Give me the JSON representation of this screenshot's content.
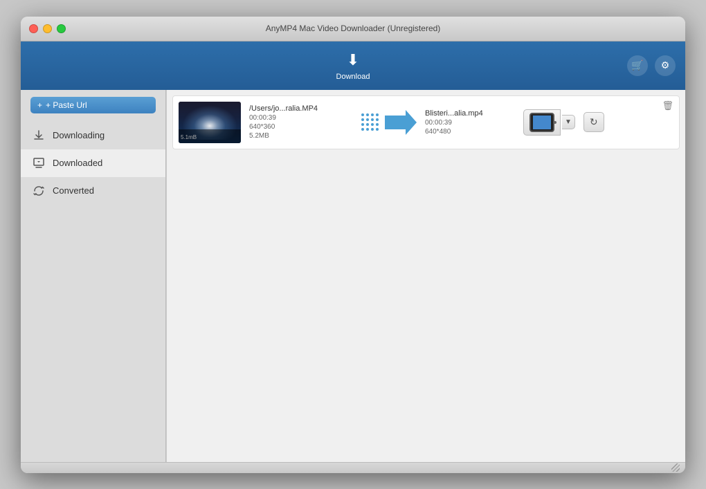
{
  "window": {
    "title": "AnyMP4 Mac Video Downloader (Unregistered)"
  },
  "toolbar": {
    "download_label": "Download",
    "cart_icon": "🛒",
    "settings_icon": "⚙"
  },
  "sidebar": {
    "paste_btn": "+ Paste Url",
    "items": [
      {
        "id": "downloading",
        "label": "Downloading",
        "icon": "⬇"
      },
      {
        "id": "downloaded",
        "label": "Downloaded",
        "icon": "📥"
      },
      {
        "id": "converted",
        "label": "Converted",
        "icon": "🔄"
      }
    ],
    "active": "downloaded"
  },
  "media_item": {
    "source_filename": "/Users/jo...ralia.MP4",
    "source_duration": "00:00:39",
    "source_resolution": "640*360",
    "source_size": "5.2MB",
    "output_filename": "Blisteri...alia.mp4",
    "output_duration": "00:00:39",
    "output_resolution": "640*480",
    "format": "iPad",
    "trash_icon": "🗑"
  }
}
